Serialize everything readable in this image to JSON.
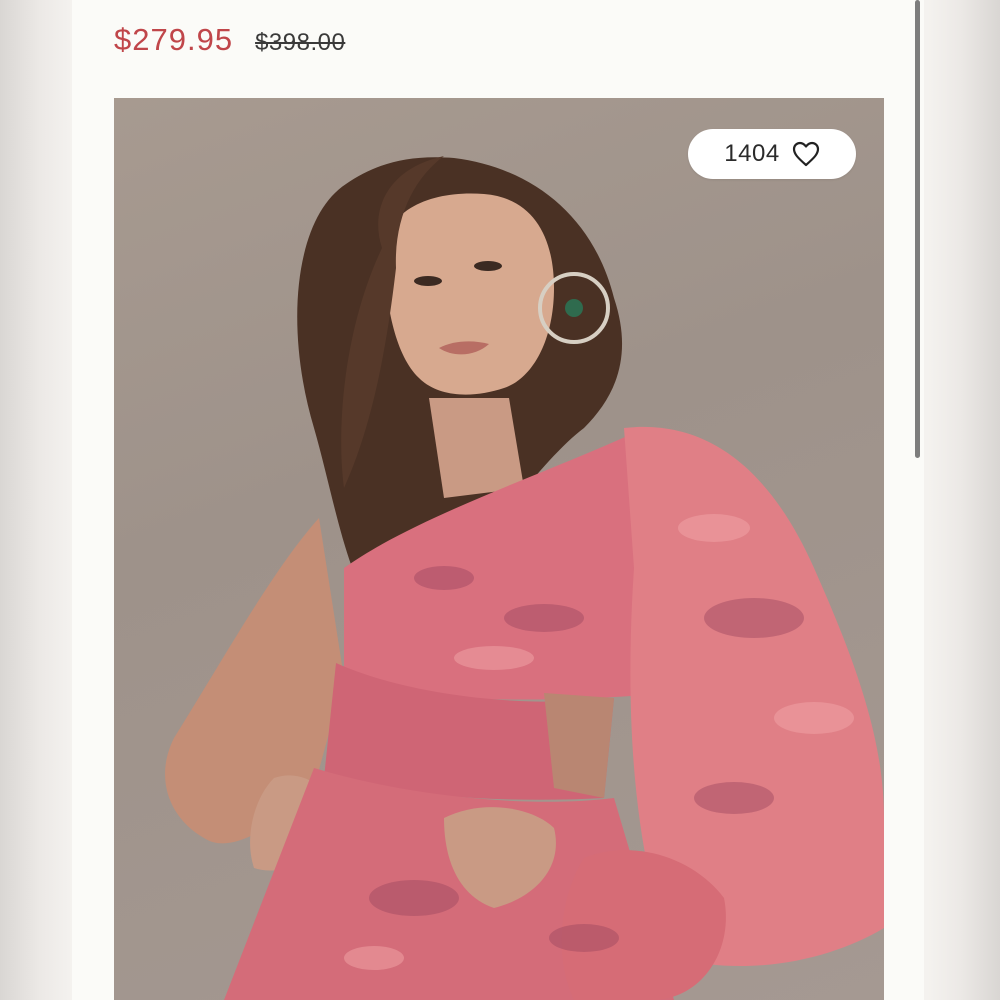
{
  "product": {
    "sale_price": "$279.95",
    "original_price": "$398.00",
    "like_count": "1404",
    "icons": {
      "like": "heart-outline-icon"
    }
  },
  "colors": {
    "sale_price": "#c0464a",
    "card_background": "#fbfbf8",
    "dress": "#d9707e"
  }
}
